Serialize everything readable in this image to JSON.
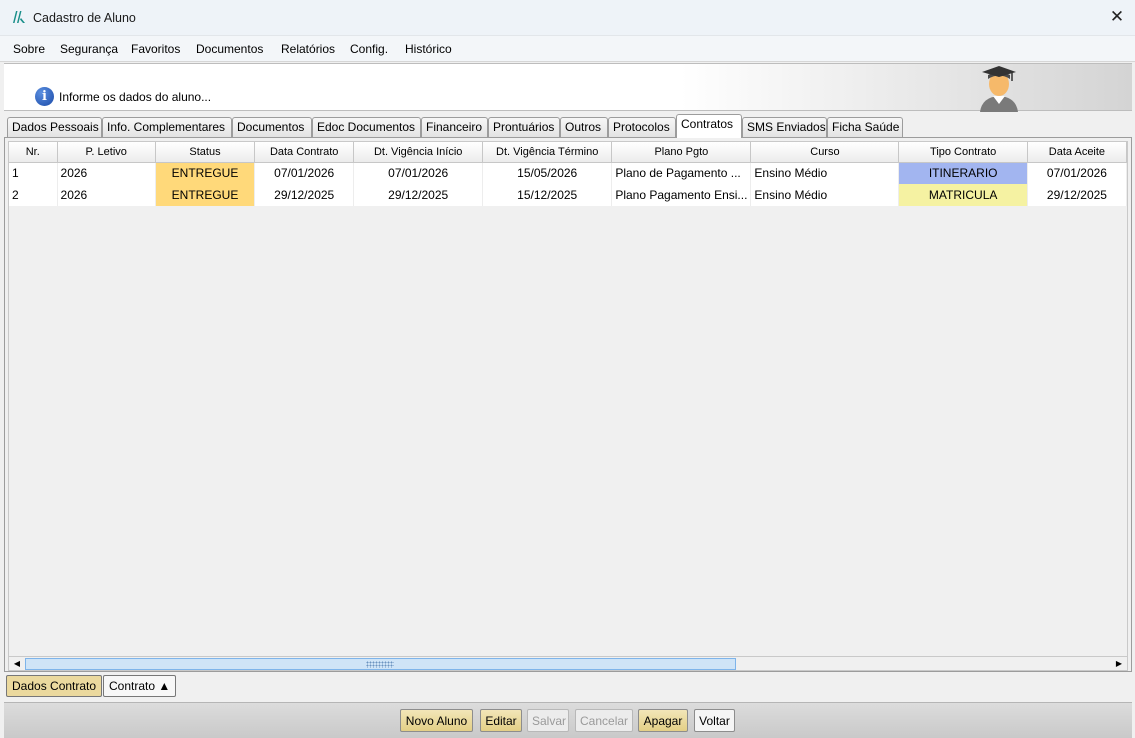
{
  "window": {
    "title": "Cadastro de Aluno",
    "close_glyph": "✕"
  },
  "menu": {
    "items": [
      "Sobre",
      "Segurança",
      "Favoritos",
      "Documentos",
      "Relatórios",
      "Config.",
      "Histórico"
    ]
  },
  "header": {
    "message": "Informe os dados do aluno...",
    "info_glyph": "i"
  },
  "tabs": [
    "Dados Pessoais",
    "Info. Complementares",
    "Documentos",
    "Edoc Documentos",
    "Financeiro",
    "Prontuários",
    "Outros",
    "Protocolos",
    "Contratos",
    "SMS Enviados",
    "Ficha Saúde"
  ],
  "active_tab": "Contratos",
  "grid": {
    "columns": [
      "Nr.",
      "P. Letivo",
      "Status",
      "Data Contrato",
      "Dt. Vigência Início",
      "Dt. Vigência Término",
      "Plano Pgto",
      "Curso",
      "Tipo Contrato",
      "Data Aceite"
    ],
    "rows": [
      {
        "nr": "1",
        "letivo": "2026",
        "status": "ENTREGUE",
        "data_contrato": "07/01/2026",
        "inicio": "07/01/2026",
        "termino": "15/05/2026",
        "plano": "Plano de Pagamento ...",
        "curso": "Ensino Médio",
        "tipo": "ITINERARIO",
        "aceite": "07/01/2026"
      },
      {
        "nr": "2",
        "letivo": "2026",
        "status": "ENTREGUE",
        "data_contrato": "29/12/2025",
        "inicio": "29/12/2025",
        "termino": "15/12/2025",
        "plano": "Plano Pagamento Ensi...",
        "curso": "Ensino Médio",
        "tipo": "MATRICULA",
        "aceite": "29/12/2025"
      }
    ]
  },
  "scrollbar": {
    "left_arrow": "◀",
    "right_arrow": "▶"
  },
  "subtabs": {
    "dados_contrato": "Dados Contrato",
    "contrato": "Contrato ▲"
  },
  "buttons": {
    "novo_aluno": "Novo Aluno",
    "editar": "Editar",
    "salvar": "Salvar",
    "cancelar": "Cancelar",
    "apagar": "Apagar",
    "voltar": "Voltar"
  },
  "colors": {
    "status_bg": "#ffd97a",
    "tipo_itinerario_bg": "#a2b5f0",
    "tipo_matricula_bg": "#f5f2a2",
    "button_active_bg": "#e3cf86"
  }
}
